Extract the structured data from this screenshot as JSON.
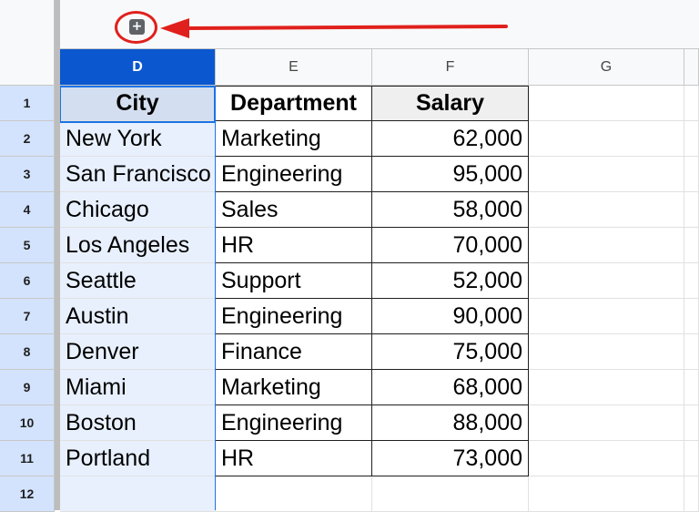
{
  "colors": {
    "selected_column_header": "#0b57d0",
    "selected_column_fill": "#e8f0fe",
    "row_header_fill": "#d3e3fd",
    "annotation_red": "#e0201c",
    "active_cell_border": "#1a73e8"
  },
  "group_control": {
    "expand_icon": "plus-square-icon",
    "expand_symbol": "+"
  },
  "annotation": {
    "shape": "circle-and-arrow",
    "color": "#e0201c"
  },
  "columns": [
    "D",
    "E",
    "F",
    "G"
  ],
  "selected_column": "D",
  "rows": [
    "1",
    "2",
    "3",
    "4",
    "5",
    "6",
    "7",
    "8",
    "9",
    "10",
    "11",
    "12"
  ],
  "table": {
    "headers": [
      "City",
      "Department",
      "Salary"
    ],
    "records": [
      [
        "New York",
        "Marketing",
        "62,000"
      ],
      [
        "San Francisco",
        "Engineering",
        "95,000"
      ],
      [
        "Chicago",
        "Sales",
        "58,000"
      ],
      [
        "Los Angeles",
        "HR",
        "70,000"
      ],
      [
        "Seattle",
        "Support",
        "52,000"
      ],
      [
        "Austin",
        "Engineering",
        "90,000"
      ],
      [
        "Denver",
        "Finance",
        "75,000"
      ],
      [
        "Miami",
        "Marketing",
        "68,000"
      ],
      [
        "Boston",
        "Engineering",
        "88,000"
      ],
      [
        "Portland",
        "HR",
        "73,000"
      ]
    ]
  }
}
